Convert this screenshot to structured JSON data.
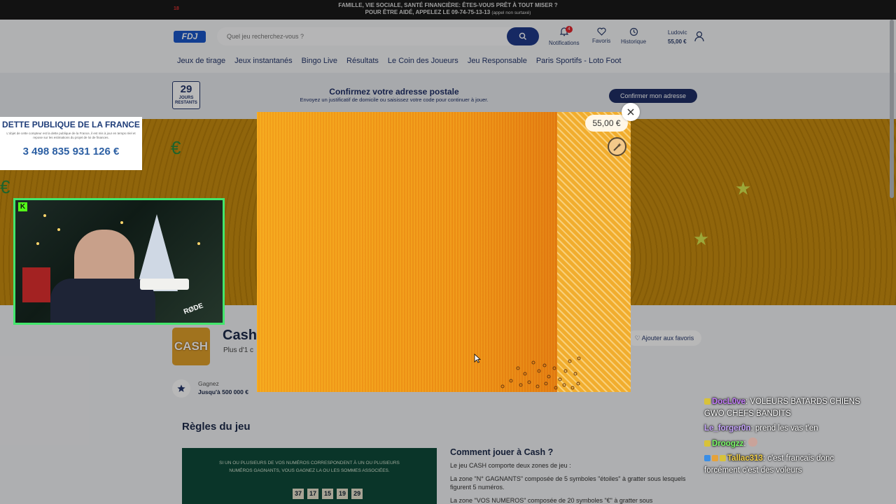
{
  "warning": {
    "age": "18",
    "line1": "FAMILLE, VIE SOCIALE, SANTÉ FINANCIÈRE: ÊTES-VOUS PRÊT À TOUT MISER ?",
    "line2": "POUR ÊTRE AIDÉ, APPELEZ LE 09-74-75-13-13",
    "line2_small": "(appel non surtaxé)"
  },
  "header": {
    "logo": "FDJ",
    "search_placeholder": "Quel jeu recherchez-vous ?",
    "notifications_label": "Notifications",
    "notifications_count": "4",
    "favoris_label": "Favoris",
    "historique_label": "Historique",
    "user_name": "Ludovic",
    "balance": "55,00 €"
  },
  "nav": [
    "Jeux de tirage",
    "Jeux instantanés",
    "Bingo Live",
    "Résultats",
    "Le Coin des Joueurs",
    "Jeu Responsable",
    "Paris Sportifs - Loto Foot"
  ],
  "notice": {
    "days": "29",
    "days_label1": "JOURS",
    "days_label2": "RESTANTS",
    "title": "Confirmez votre adresse postale",
    "subtitle": "Envoyez un justificatif de domicile ou saisissez votre code pour continuer à jouer.",
    "button": "Confirmer mon adresse"
  },
  "game": {
    "logo_text": "CASH",
    "title": "Cash",
    "subtitle": "Plus d'1 c",
    "fav_button": "Ajouter aux favoris",
    "win_label": "Gagnez",
    "win_value": "Jusqu'à 500 000 €",
    "rules_heading": "Règles du jeu",
    "rules_image_text": "SI UN OU PLUSIEURS DE VOS NUMÉROS CORRESPONDENT À UN OU PLUSIEURS NUMÉROS GAGNANTS, VOUS GAGNEZ LA OU LES SOMMES ASSOCIÉES.",
    "rules_numbers": [
      "37",
      "17",
      "15",
      "19",
      "29"
    ],
    "how_heading": "Comment jouer à Cash ?",
    "how_p1": "Le jeu CASH comporte deux zones de jeu :",
    "how_p2": "La zone \"N° GAGNANTS\" composée de 5 symboles \"étoiles\" à gratter sous lesquels figurent 5 numéros.",
    "how_p3": "La zone \"VOS NUMEROS\" composée de 20 symboles \"€\" à gratter sous"
  },
  "modal": {
    "price": "55,00 €"
  },
  "debt": {
    "title": "DETTE PUBLIQUE DE LA FRANCE",
    "subtitle": "L'objet de cette compteur est la dette publique de la France, il est mis à jour en temps réel et repose sur les estimations du projet de loi de finances.",
    "value": "3 498 835 931 126 €"
  },
  "chat": [
    {
      "user": "DocL0ve",
      "color": "#c77dff",
      "text": "VOLEURS BATARDS CHIENS GWO CHEFS BANDITS"
    },
    {
      "user": "Le_forger0n",
      "color": "#c9a7ff",
      "text": "prend les vas t'en"
    },
    {
      "user": "Droogzz",
      "color": "#7cfc6a",
      "text": ""
    },
    {
      "user": "Tallac313",
      "color": "#f6d34a",
      "text": "c'est francais donc forcément c'est des voleurs"
    }
  ],
  "colors": {
    "brand": "#1a57c9",
    "navy": "#1f2f66",
    "cam_border": "#43e66c"
  }
}
